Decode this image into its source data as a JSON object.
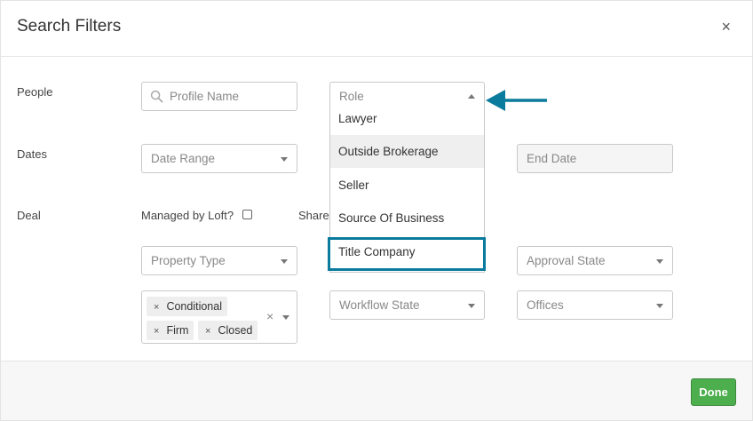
{
  "modal": {
    "title": "Search Filters",
    "close_label": "×"
  },
  "people": {
    "label": "People",
    "profile_placeholder": "Profile Name",
    "role_placeholder": "Role",
    "role_options": [
      "Lawyer",
      "Outside Brokerage",
      "Seller",
      "Source Of Business",
      "Title Company"
    ],
    "hovered_option": "Outside Brokerage",
    "highlighted_option": "Title Company"
  },
  "dates": {
    "label": "Dates",
    "range_placeholder": "Date Range",
    "end_placeholder": "End Date"
  },
  "deal": {
    "label": "Deal",
    "managed_by_label": "Managed by Loft?",
    "shared_label": "Share",
    "property_type_placeholder": "Property Type",
    "approval_state_placeholder": "Approval State",
    "workflow_state_placeholder": "Workflow State",
    "offices_placeholder": "Offices",
    "status_tags": [
      "Conditional",
      "Firm",
      "Closed"
    ],
    "tag_remove": "×",
    "clear_all": "×"
  },
  "footer": {
    "done_label": "Done"
  },
  "colors": {
    "highlight": "#0a7b9c",
    "done_button": "#4cae4c"
  }
}
